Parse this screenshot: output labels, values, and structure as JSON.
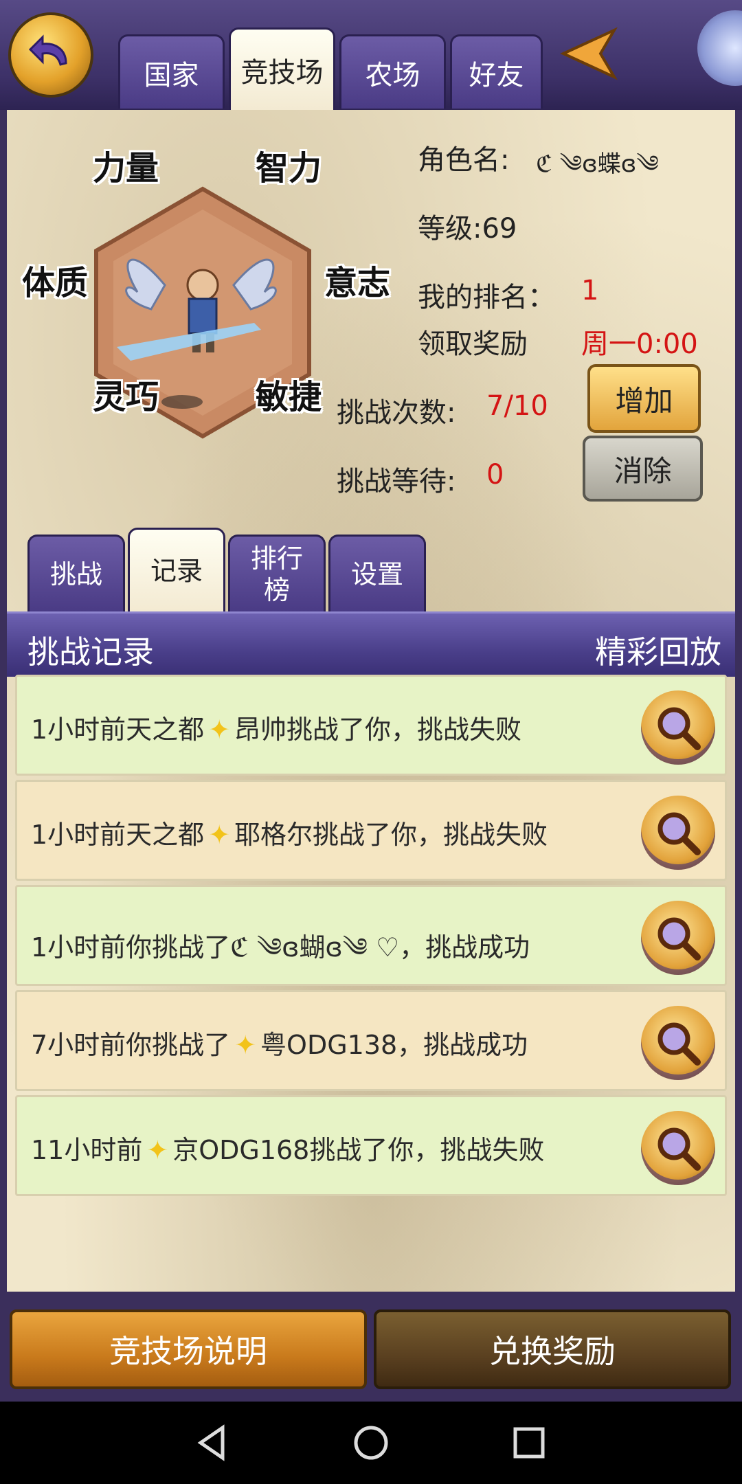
{
  "top_tabs": [
    {
      "label": "国家"
    },
    {
      "label": "竞技场"
    },
    {
      "label": "农场"
    },
    {
      "label": "好友"
    }
  ],
  "active_top_tab": "竞技场",
  "character": {
    "stats": {
      "strength": "力量",
      "intelligence": "智力",
      "constitution": "体质",
      "willpower": "意志",
      "dexterity": "灵巧",
      "agility": "敏捷"
    },
    "name_label": "角色名:",
    "name_value": "ℭ ༄ɞ蝶ɞ༄",
    "level_text": "等级:69",
    "rank_label": "我的排名：",
    "rank_value": "1",
    "reward_label": "领取奖励",
    "reward_value": "周一0:00",
    "challenges_label": "挑战次数:",
    "challenges_value": "7/10",
    "wait_label": "挑战等待:",
    "wait_value": "0",
    "add_button": "增加",
    "clear_button": "消除"
  },
  "sub_tabs": [
    {
      "label": "挑战"
    },
    {
      "label": "记录"
    },
    {
      "label": "排行榜"
    },
    {
      "label": "设置"
    }
  ],
  "active_sub_tab": "记录",
  "records": {
    "title": "挑战记录",
    "replay_label": "精彩回放",
    "items": [
      {
        "pre": "1小时前天之都",
        "post": "昂帅挑战了你，挑战失败"
      },
      {
        "pre": "1小时前天之都",
        "post": "耶格尔挑战了你，挑战失败"
      },
      {
        "pre": "1小时前你挑战了ℭ ༄ɞ蝴ɞ༄ ♡",
        "post": "，挑战成功"
      },
      {
        "pre": "7小时前你挑战了",
        "post": "粤ODG138，挑战成功"
      },
      {
        "pre": "11小时前",
        "post": "京ODG168挑战了你，挑战失败"
      }
    ]
  },
  "bottom": {
    "rules_button": "竞技场说明",
    "exchange_button": "兑换奖励"
  },
  "colors": {
    "accent_purple": "#4a3b85",
    "panel_bg": "#f1e7cb",
    "row_green": "#e7f3c6",
    "row_beige": "#f5e6c2",
    "highlight_red": "#d41414"
  },
  "icons": {
    "back": "back-arrow-icon",
    "more": "arrow-left-icon",
    "replay": "magnifier-icon",
    "sparkle": "sparkle-icon"
  }
}
